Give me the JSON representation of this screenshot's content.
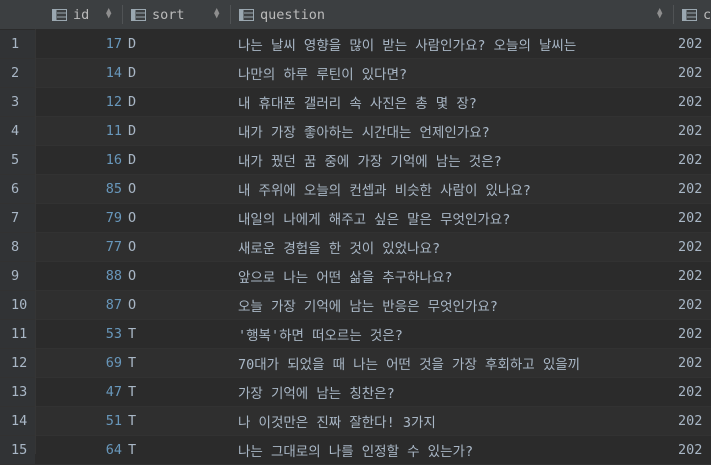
{
  "columns": {
    "id": "id",
    "sort": "sort",
    "question": "question",
    "date": "c"
  },
  "rows": [
    {
      "n": "1",
      "id": "17",
      "sort": "D",
      "question": "나는 날씨 영향을 많이 받는 사람인가요? 오늘의 날씨는",
      "date": "202"
    },
    {
      "n": "2",
      "id": "14",
      "sort": "D",
      "question": "나만의 하루 루틴이 있다면?",
      "date": "202"
    },
    {
      "n": "3",
      "id": "12",
      "sort": "D",
      "question": "내 휴대폰 갤러리 속 사진은 총 몇 장?",
      "date": "202"
    },
    {
      "n": "4",
      "id": "11",
      "sort": "D",
      "question": "내가 가장 좋아하는 시간대는 언제인가요?",
      "date": "202"
    },
    {
      "n": "5",
      "id": "16",
      "sort": "D",
      "question": "내가 꿨던 꿈 중에 가장 기억에 남는 것은?",
      "date": "202"
    },
    {
      "n": "6",
      "id": "85",
      "sort": "O",
      "question": "내 주위에 오늘의 컨셉과 비슷한 사람이 있나요?",
      "date": "202"
    },
    {
      "n": "7",
      "id": "79",
      "sort": "O",
      "question": "내일의 나에게 해주고 싶은 말은 무엇인가요?",
      "date": "202"
    },
    {
      "n": "8",
      "id": "77",
      "sort": "O",
      "question": "새로운 경험을 한 것이 있었나요?",
      "date": "202"
    },
    {
      "n": "9",
      "id": "88",
      "sort": "O",
      "question": "앞으로 나는 어떤 삶을 추구하나요?",
      "date": "202"
    },
    {
      "n": "10",
      "id": "87",
      "sort": "O",
      "question": "오늘 가장 기억에 남는 반응은 무엇인가요?",
      "date": "202"
    },
    {
      "n": "11",
      "id": "53",
      "sort": "T",
      "question": "'행복'하면 떠오르는 것은?",
      "date": "202"
    },
    {
      "n": "12",
      "id": "69",
      "sort": "T",
      "question": "70대가 되었을 때 나는 어떤 것을 가장 후회하고 있을끼",
      "date": "202"
    },
    {
      "n": "13",
      "id": "47",
      "sort": "T",
      "question": "가장 기억에 남는 칭찬은?",
      "date": "202"
    },
    {
      "n": "14",
      "id": "51",
      "sort": "T",
      "question": "나 이것만은 진짜 잘한다! 3가지",
      "date": "202"
    },
    {
      "n": "15",
      "id": "64",
      "sort": "T",
      "question": "나는 그대로의 나를 인정할 수 있는가?",
      "date": "202"
    }
  ]
}
